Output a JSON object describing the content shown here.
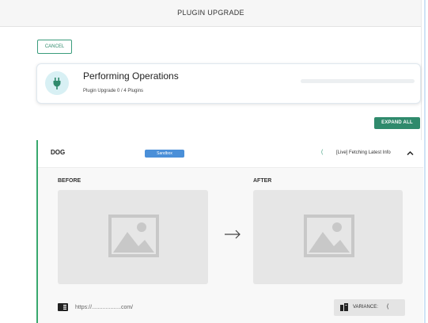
{
  "header": {
    "title": "PLUGIN UPGRADE"
  },
  "actions": {
    "cancel_label": "CANCEL",
    "expand_all_label": "EXPAND ALL"
  },
  "operations": {
    "title": "Performing Operations",
    "subtitle": "Plugin Upgrade 0 / 4 Plugins",
    "icon": "plug-icon",
    "progress": 0.0
  },
  "plugin": {
    "name": "DOG",
    "environment_badge": "Sandbox",
    "status_text": "[Live] Fetching Latest Info",
    "before_label": "BEFORE",
    "after_label": "AFTER",
    "url_text": "https://...................com/",
    "variance_label": "VARIANCE:"
  },
  "colors": {
    "accent_green": "#2f8a6c",
    "badge_blue": "#4a8fd8",
    "panel_border": "#38a86d"
  }
}
